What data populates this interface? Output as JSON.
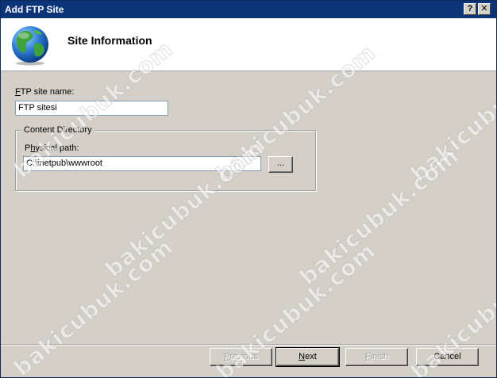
{
  "window": {
    "title": "Add FTP Site",
    "help_glyph": "?",
    "close_glyph": "✕"
  },
  "header": {
    "title": "Site Information",
    "icon": "globe-icon"
  },
  "form": {
    "site_name_label": "FTP site name:",
    "site_name_value": "FTP sitesi",
    "content_group_label": "Content Directory",
    "physical_path_label": "Physical path:",
    "physical_path_value": "C:\\inetpub\\wwwroot",
    "browse_label": "..."
  },
  "buttons": {
    "previous": "Previous",
    "next": "Next",
    "finish": "Finish",
    "cancel": "Cancel"
  },
  "watermark": {
    "text": "bakicubuk.com"
  },
  "colors": {
    "titlebar": "#0b3479",
    "dialog_bg": "#d4d0c8",
    "header_bg": "#ffffff"
  }
}
